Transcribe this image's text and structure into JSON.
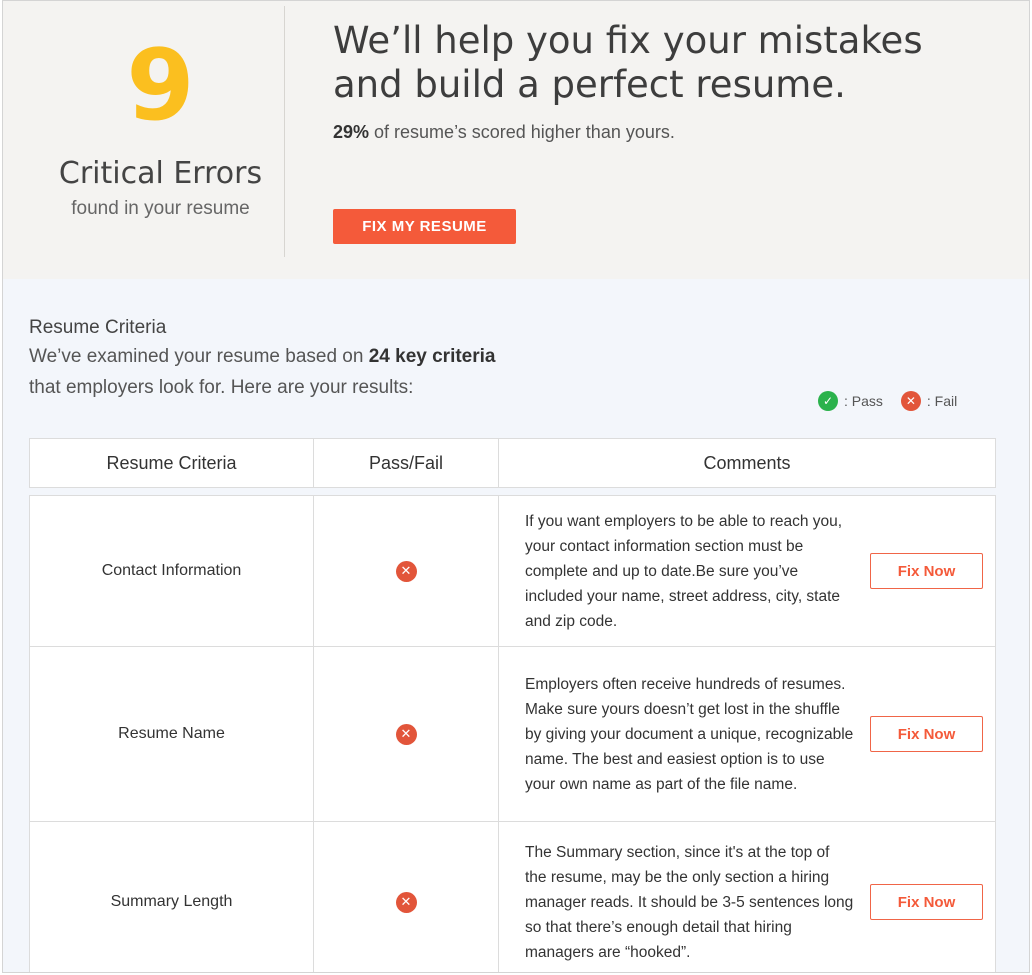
{
  "hero": {
    "score": "9",
    "score_title": "Critical Errors",
    "score_sub": "found in your resume",
    "headline": "We’ll help you fix your mistakes and build a perfect resume.",
    "percent": "29%",
    "subline_rest": " of resume’s scored higher than yours.",
    "button": "FIX MY RESUME"
  },
  "criteria": {
    "title": "Resume Criteria",
    "desc_prefix": "We’ve examined your resume based on ",
    "desc_bold": "24 key criteria",
    "desc_line2": "that employers look for. Here are your results:",
    "legend": {
      "pass": ": Pass",
      "fail": ": Fail"
    },
    "headers": [
      "Resume Criteria",
      "Pass/Fail",
      "Comments"
    ],
    "rows": [
      {
        "name": "Contact Information",
        "status": "fail",
        "comment": "If you want employers to be able to reach you, your contact information section must be complete and up to date.Be sure you’ve included your name, street address, city, state and zip code.",
        "action": "Fix Now"
      },
      {
        "name": "Resume Name",
        "status": "fail",
        "comment": "Employers often receive hundreds of resumes. Make sure yours doesn’t get lost in the shuffle by giving your document a unique, recognizable name. The best and easiest option is to use your own name as part of the file name.",
        "action": "Fix Now"
      },
      {
        "name": "Summary Length",
        "status": "fail",
        "comment": "The Summary section, since it's at the top of the resume, may be the only section a hiring manager reads. It should be 3-5 sentences long so that there’s enough detail that hiring managers are “hooked”.",
        "action": "Fix Now"
      }
    ]
  },
  "colors": {
    "accent": "#f45a3a",
    "score": "#fbbf1f",
    "pass": "#2bb24c",
    "fail": "#e2553a"
  },
  "icons": {
    "pass": "check-circle-icon",
    "fail": "x-circle-icon"
  }
}
